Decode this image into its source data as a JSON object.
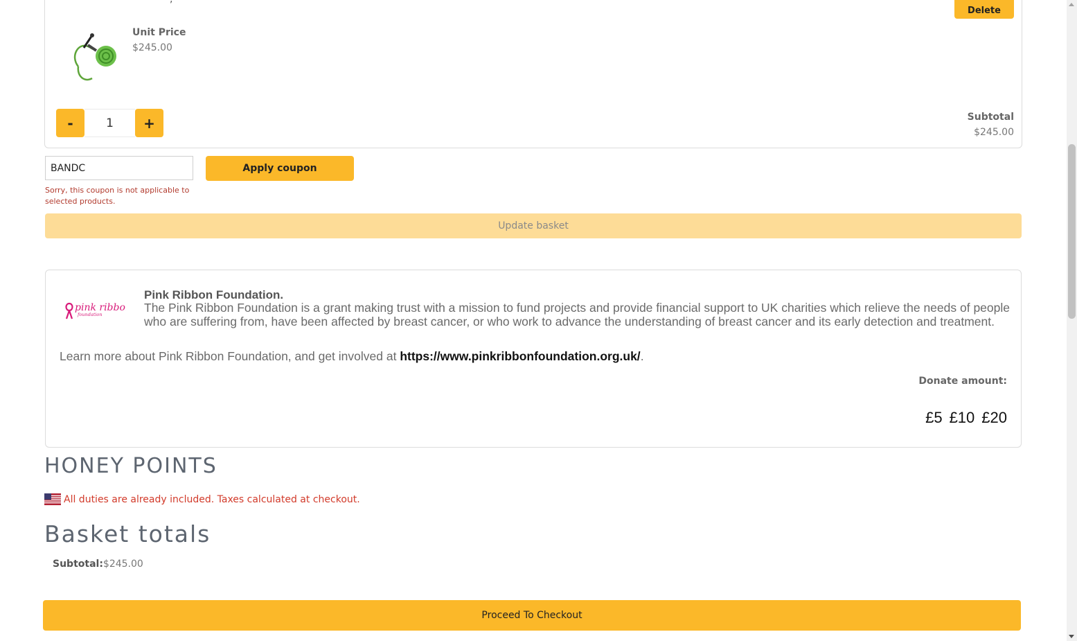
{
  "cart_item": {
    "partial_title": ", ",
    "delete_label": "Delete",
    "unit_price_label": "Unit Price",
    "unit_price_value": "$245.00",
    "quantity": "1",
    "minus_label": "-",
    "plus_label": "+",
    "subtotal_label": "Subtotal",
    "subtotal_value": "$245.00",
    "image_icon": "green-rope-lanyard-image"
  },
  "coupon": {
    "value": "BANDC",
    "apply_label": "Apply coupon",
    "error_message": "Sorry, this coupon is not applicable to selected products."
  },
  "update_basket_label": "Update basket",
  "charity": {
    "logo_text": "pink ribbon",
    "logo_subtext": "foundation",
    "name": "Pink Ribbon Foundation.",
    "description": "The Pink Ribbon Foundation is a grant making trust with a mission to fund projects and provide financial support to UK charities which relieve the needs of people who are suffering from, have been affected by breast cancer, or who work to advance the understanding of breast cancer and its early detection and treatment.",
    "learn_more_prefix": "Learn more about Pink Ribbon Foundation, and get involved at ",
    "learn_more_link": "https://www.pinkribbonfoundation.org.uk/",
    "learn_more_suffix": ".",
    "donate_label": "Donate amount:",
    "donate_options": [
      "£5",
      "£10",
      "£20"
    ]
  },
  "honey_points_title": "HONEY POINTS",
  "duties_note": "All duties are already included. Taxes calculated at checkout.",
  "basket_totals": {
    "title": "Basket totals",
    "subtotal_label": "Subtotal:",
    "subtotal_value": "$245.00"
  },
  "checkout_label": "Proceed To Checkout",
  "colors": {
    "accent": "#fbb829",
    "accent_disabled": "#fddc97",
    "error": "#d23a2a",
    "pink": "#d81b7a"
  }
}
